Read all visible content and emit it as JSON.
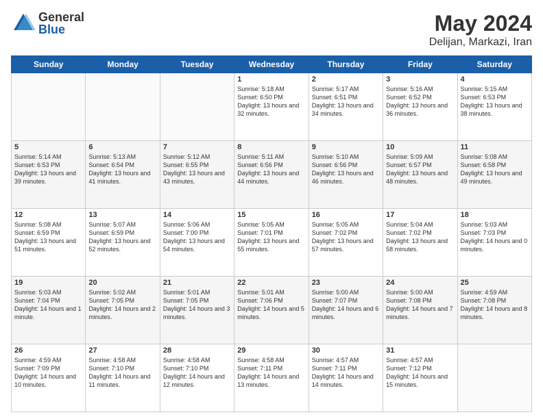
{
  "logo": {
    "general": "General",
    "blue": "Blue"
  },
  "title": "May 2024",
  "subtitle": "Delijan, Markazi, Iran",
  "days": [
    "Sunday",
    "Monday",
    "Tuesday",
    "Wednesday",
    "Thursday",
    "Friday",
    "Saturday"
  ],
  "weeks": [
    [
      {
        "day": "",
        "content": ""
      },
      {
        "day": "",
        "content": ""
      },
      {
        "day": "",
        "content": ""
      },
      {
        "day": "1",
        "content": "Sunrise: 5:18 AM\nSunset: 6:50 PM\nDaylight: 13 hours and 32 minutes."
      },
      {
        "day": "2",
        "content": "Sunrise: 5:17 AM\nSunset: 6:51 PM\nDaylight: 13 hours and 34 minutes."
      },
      {
        "day": "3",
        "content": "Sunrise: 5:16 AM\nSunset: 6:52 PM\nDaylight: 13 hours and 36 minutes."
      },
      {
        "day": "4",
        "content": "Sunrise: 5:15 AM\nSunset: 6:53 PM\nDaylight: 13 hours and 38 minutes."
      }
    ],
    [
      {
        "day": "5",
        "content": "Sunrise: 5:14 AM\nSunset: 6:53 PM\nDaylight: 13 hours and 39 minutes."
      },
      {
        "day": "6",
        "content": "Sunrise: 5:13 AM\nSunset: 6:54 PM\nDaylight: 13 hours and 41 minutes."
      },
      {
        "day": "7",
        "content": "Sunrise: 5:12 AM\nSunset: 6:55 PM\nDaylight: 13 hours and 43 minutes."
      },
      {
        "day": "8",
        "content": "Sunrise: 5:11 AM\nSunset: 6:56 PM\nDaylight: 13 hours and 44 minutes."
      },
      {
        "day": "9",
        "content": "Sunrise: 5:10 AM\nSunset: 6:56 PM\nDaylight: 13 hours and 46 minutes."
      },
      {
        "day": "10",
        "content": "Sunrise: 5:09 AM\nSunset: 6:57 PM\nDaylight: 13 hours and 48 minutes."
      },
      {
        "day": "11",
        "content": "Sunrise: 5:08 AM\nSunset: 6:58 PM\nDaylight: 13 hours and 49 minutes."
      }
    ],
    [
      {
        "day": "12",
        "content": "Sunrise: 5:08 AM\nSunset: 6:59 PM\nDaylight: 13 hours and 51 minutes."
      },
      {
        "day": "13",
        "content": "Sunrise: 5:07 AM\nSunset: 6:59 PM\nDaylight: 13 hours and 52 minutes."
      },
      {
        "day": "14",
        "content": "Sunrise: 5:06 AM\nSunset: 7:00 PM\nDaylight: 13 hours and 54 minutes."
      },
      {
        "day": "15",
        "content": "Sunrise: 5:05 AM\nSunset: 7:01 PM\nDaylight: 13 hours and 55 minutes."
      },
      {
        "day": "16",
        "content": "Sunrise: 5:05 AM\nSunset: 7:02 PM\nDaylight: 13 hours and 57 minutes."
      },
      {
        "day": "17",
        "content": "Sunrise: 5:04 AM\nSunset: 7:02 PM\nDaylight: 13 hours and 58 minutes."
      },
      {
        "day": "18",
        "content": "Sunrise: 5:03 AM\nSunset: 7:03 PM\nDaylight: 14 hours and 0 minutes."
      }
    ],
    [
      {
        "day": "19",
        "content": "Sunrise: 5:03 AM\nSunset: 7:04 PM\nDaylight: 14 hours and 1 minute."
      },
      {
        "day": "20",
        "content": "Sunrise: 5:02 AM\nSunset: 7:05 PM\nDaylight: 14 hours and 2 minutes."
      },
      {
        "day": "21",
        "content": "Sunrise: 5:01 AM\nSunset: 7:05 PM\nDaylight: 14 hours and 3 minutes."
      },
      {
        "day": "22",
        "content": "Sunrise: 5:01 AM\nSunset: 7:06 PM\nDaylight: 14 hours and 5 minutes."
      },
      {
        "day": "23",
        "content": "Sunrise: 5:00 AM\nSunset: 7:07 PM\nDaylight: 14 hours and 6 minutes."
      },
      {
        "day": "24",
        "content": "Sunrise: 5:00 AM\nSunset: 7:08 PM\nDaylight: 14 hours and 7 minutes."
      },
      {
        "day": "25",
        "content": "Sunrise: 4:59 AM\nSunset: 7:08 PM\nDaylight: 14 hours and 8 minutes."
      }
    ],
    [
      {
        "day": "26",
        "content": "Sunrise: 4:59 AM\nSunset: 7:09 PM\nDaylight: 14 hours and 10 minutes."
      },
      {
        "day": "27",
        "content": "Sunrise: 4:58 AM\nSunset: 7:10 PM\nDaylight: 14 hours and 11 minutes."
      },
      {
        "day": "28",
        "content": "Sunrise: 4:58 AM\nSunset: 7:10 PM\nDaylight: 14 hours and 12 minutes."
      },
      {
        "day": "29",
        "content": "Sunrise: 4:58 AM\nSunset: 7:11 PM\nDaylight: 14 hours and 13 minutes."
      },
      {
        "day": "30",
        "content": "Sunrise: 4:57 AM\nSunset: 7:11 PM\nDaylight: 14 hours and 14 minutes."
      },
      {
        "day": "31",
        "content": "Sunrise: 4:57 AM\nSunset: 7:12 PM\nDaylight: 14 hours and 15 minutes."
      },
      {
        "day": "",
        "content": ""
      }
    ]
  ]
}
